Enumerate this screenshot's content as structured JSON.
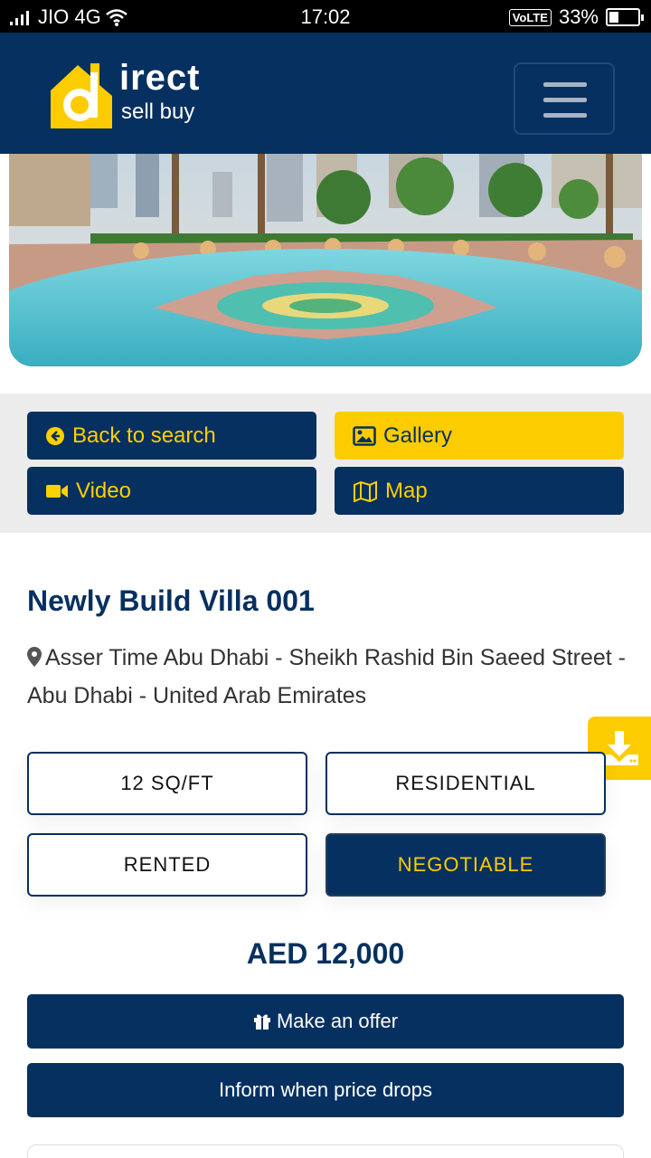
{
  "status_bar": {
    "carrier": "JIO 4G",
    "time": "17:02",
    "volte": "VoLTE",
    "battery_percent": "33%",
    "battery_level": 0.33
  },
  "header": {
    "logo_line1": "irect",
    "logo_line2": "sell buy",
    "menu_icon": "hamburger-icon"
  },
  "actions": {
    "back": "Back to search",
    "gallery": "Gallery",
    "video": "Video",
    "map": "Map"
  },
  "listing": {
    "title": "Newly Build Villa 001",
    "address": "Asser Time Abu Dhabi - Sheikh Rashid Bin Saeed Street - Abu Dhabi - United Arab Emirates",
    "tags": {
      "area": "12 SQ/FT",
      "type": "RESIDENTIAL",
      "status": "RENTED",
      "pricing": "NEGOTIABLE"
    },
    "price": "AED 12,000"
  },
  "buttons": {
    "offer": "Make an offer",
    "inform": "Inform when price drops"
  },
  "colors": {
    "navy": "#06305f",
    "yellow": "#fdcc00"
  }
}
